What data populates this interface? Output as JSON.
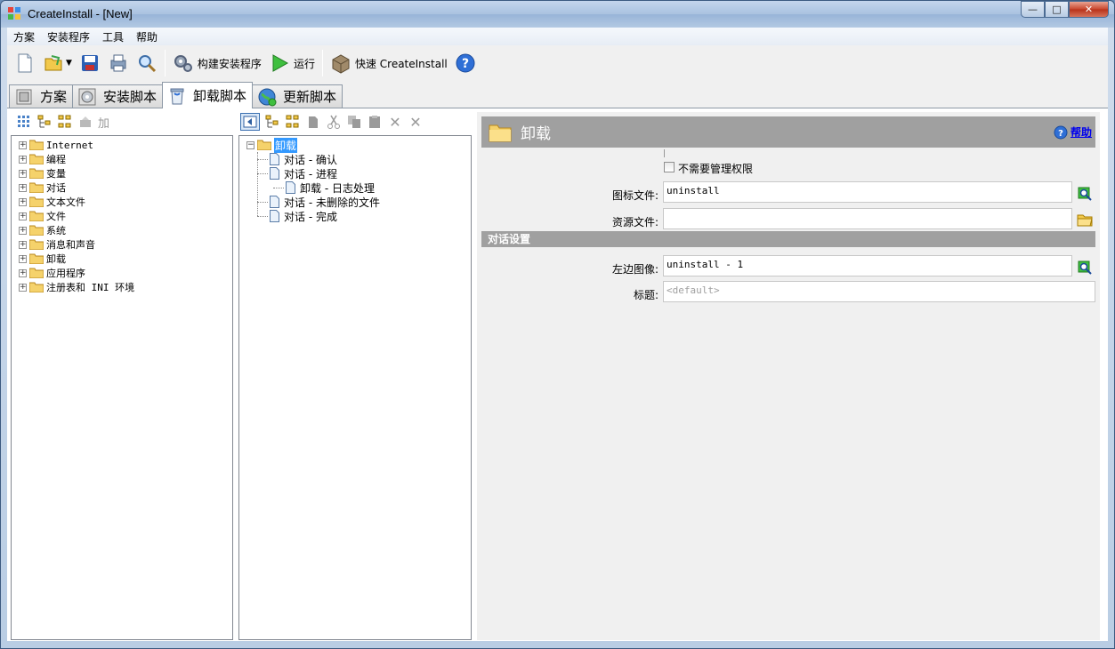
{
  "window": {
    "title": "CreateInstall - [New]"
  },
  "menu": [
    "方案",
    "安装程序",
    "工具",
    "帮助"
  ],
  "toolbar": {
    "build_label": "构建安装程序",
    "run_label": "运行",
    "quick_label": "快速 CreateInstall"
  },
  "tabs": [
    {
      "label": "方案",
      "icon": "project-icon"
    },
    {
      "label": "安装脚本",
      "icon": "disc-icon"
    },
    {
      "label": "卸载脚本",
      "icon": "trash-icon"
    },
    {
      "label": "更新脚本",
      "icon": "globe-icon"
    }
  ],
  "left_pane": {
    "add_label": "加",
    "items": [
      "Internet",
      "编程",
      "变量",
      "对话",
      "文本文件",
      "文件",
      "系统",
      "消息和声音",
      "卸载",
      "应用程序",
      "注册表和 INI 环境"
    ]
  },
  "middle_pane": {
    "root": "卸载",
    "items": [
      {
        "label": "对话 - 确认",
        "level": 1
      },
      {
        "label": "对话 - 进程",
        "level": 1
      },
      {
        "label": "卸载 - 日志处理",
        "level": 2
      },
      {
        "label": "对话 - 未删除的文件",
        "level": 1
      },
      {
        "label": "对话 - 完成",
        "level": 1
      }
    ]
  },
  "right_pane": {
    "header_title": "卸载",
    "help_label": "帮助",
    "no_admin_label": "不需要管理权限",
    "icon_file_label": "图标文件:",
    "icon_file_value": "uninstall",
    "resource_file_label": "资源文件:",
    "resource_file_value": "",
    "dialog_section": "对话设置",
    "left_image_label": "左边图像:",
    "left_image_value": "uninstall - 1",
    "caption_label": "标题:",
    "caption_value": "<default>"
  }
}
